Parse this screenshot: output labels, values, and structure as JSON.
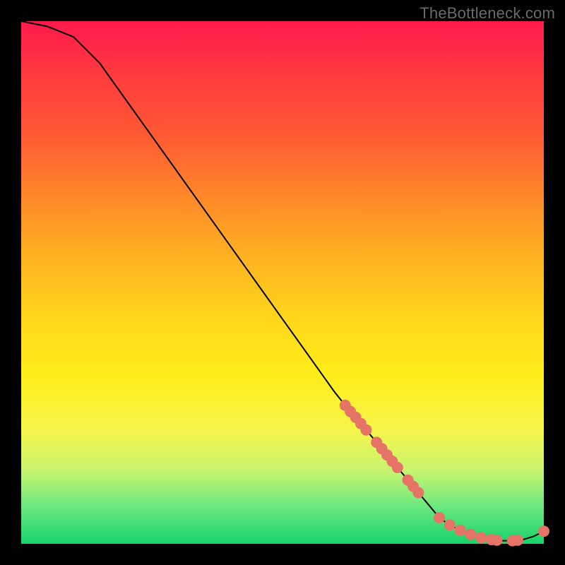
{
  "attribution": "TheBottleneck.com",
  "chart_data": {
    "type": "line",
    "title": "",
    "xlabel": "",
    "ylabel": "",
    "xlim": [
      0,
      100
    ],
    "ylim": [
      0,
      100
    ],
    "grid": false,
    "legend": false,
    "series": [
      {
        "name": "bottleneck-curve",
        "x": [
          0,
          5,
          10,
          15,
          20,
          25,
          30,
          35,
          40,
          45,
          50,
          55,
          60,
          62,
          64,
          66,
          68,
          70,
          72,
          74,
          76,
          78,
          80,
          82,
          84,
          86,
          88,
          90,
          92,
          94,
          96,
          98,
          100
        ],
        "y": [
          100,
          99,
          97,
          92,
          85,
          78,
          71,
          64,
          57,
          50,
          43,
          36,
          29,
          26.5,
          24.2,
          21.8,
          19.4,
          17,
          14.6,
          12.2,
          9.8,
          7.4,
          5,
          3.6,
          2.6,
          1.8,
          1.2,
          0.8,
          0.6,
          0.6,
          0.8,
          1.4,
          2.4
        ]
      }
    ],
    "scatter": [
      {
        "name": "highlight-points",
        "points": [
          [
            62,
            26.5
          ],
          [
            63,
            25.3
          ],
          [
            64,
            24.2
          ],
          [
            65,
            23.0
          ],
          [
            66,
            21.8
          ],
          [
            68,
            19.4
          ],
          [
            69,
            18.2
          ],
          [
            70,
            17.0
          ],
          [
            71,
            15.8
          ],
          [
            72,
            14.6
          ],
          [
            74,
            12.2
          ],
          [
            75,
            11.0
          ],
          [
            76,
            9.8
          ],
          [
            80,
            5.0
          ],
          [
            82,
            3.6
          ],
          [
            84,
            2.6
          ],
          [
            86,
            1.8
          ],
          [
            88,
            1.2
          ],
          [
            90,
            0.8
          ],
          [
            91,
            0.7
          ],
          [
            94,
            0.6
          ],
          [
            95,
            0.7
          ],
          [
            100,
            2.4
          ]
        ]
      }
    ]
  },
  "colors": {
    "dot": "#e57366",
    "line": "#000000"
  }
}
